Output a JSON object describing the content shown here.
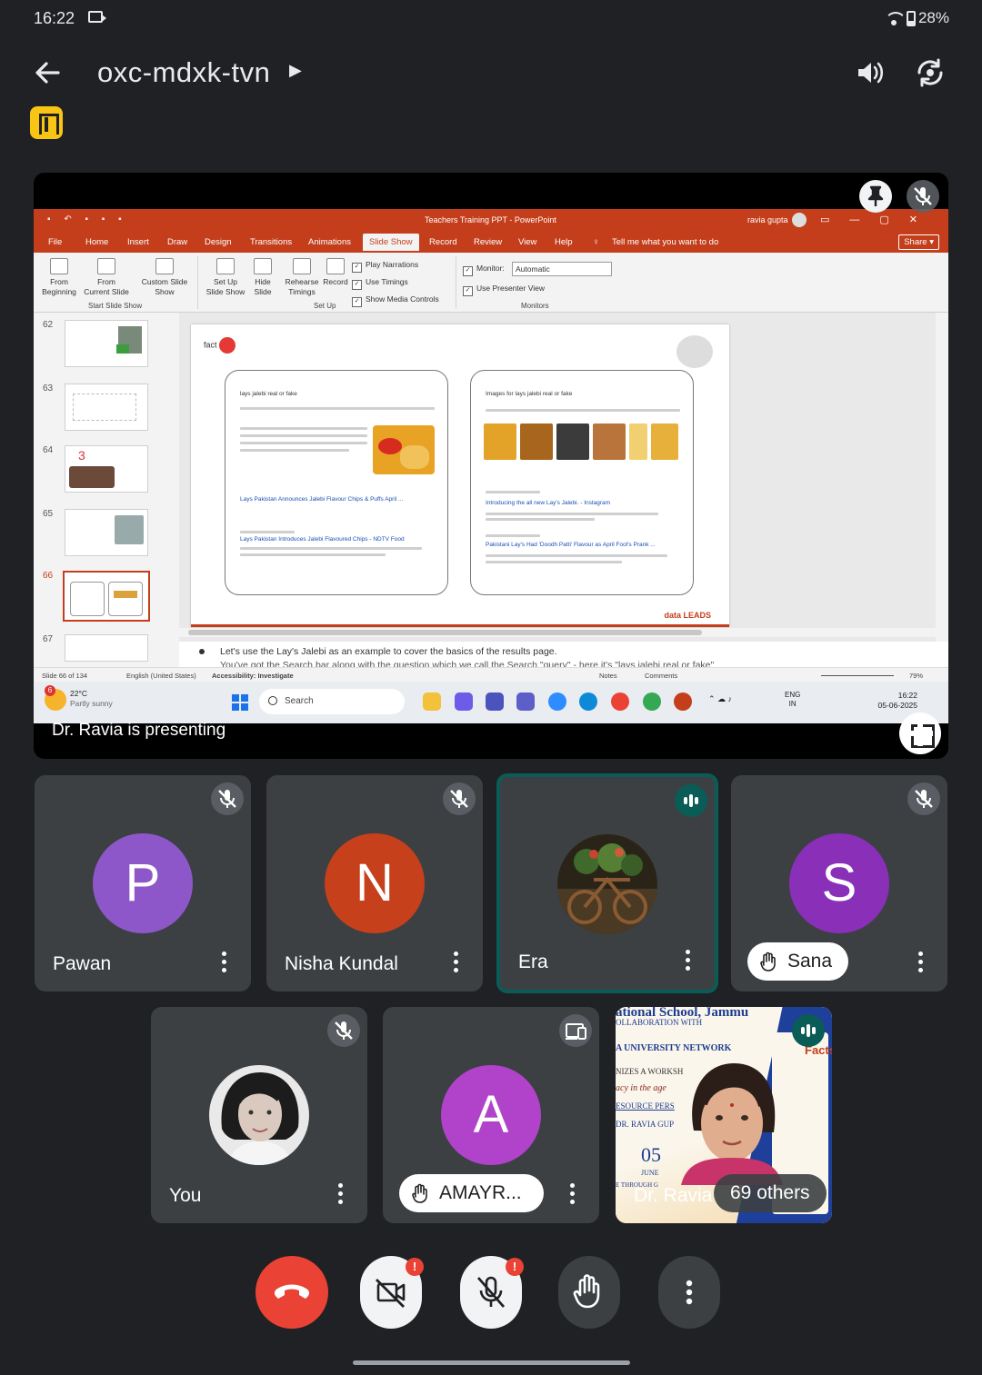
{
  "status_bar": {
    "time": "16:22",
    "battery": "28%"
  },
  "meeting": {
    "code": "oxc-mdxk-tvn"
  },
  "presentation": {
    "presenter_label": "Dr. Ravia is presenting",
    "ppt": {
      "window_title": "Teachers Training PPT  -  PowerPoint",
      "user": "ravia gupta",
      "tabs": [
        "File",
        "Home",
        "Insert",
        "Draw",
        "Design",
        "Transitions",
        "Animations",
        "Slide Show",
        "Record",
        "Review",
        "View",
        "Help"
      ],
      "tell_me": "Tell me what you want to do",
      "share": "Share",
      "ribbon": {
        "from_beginning": "From\nBeginning",
        "from_current": "From\nCurrent Slide",
        "custom_show": "Custom Slide\nShow",
        "group_start": "Start Slide Show",
        "set_up": "Set Up\nSlide Show",
        "hide_slide": "Hide\nSlide",
        "rehearse": "Rehearse\nTimings",
        "record": "Record",
        "play_narrations": "Play Narrations",
        "use_timings": "Use Timings",
        "show_media": "Show Media Controls",
        "group_setup": "Set Up",
        "monitor_label": "Monitor:",
        "monitor_value": "Automatic",
        "presenter_view": "Use Presenter View",
        "group_monitors": "Monitors"
      },
      "thumbnails": [
        "62",
        "63",
        "64",
        "65",
        "66",
        "67"
      ],
      "selected_thumbnail": "66",
      "slide": {
        "logo_text": "fact",
        "left_query": "lays jalebi real or fake",
        "left_result_1": "Lays Pakistan Announces Jalebi Flavour Chips & Puffs April ...",
        "left_result_2": "Lays Pakistan Introduces Jalebi Flavoured Chips - NDTV Food",
        "right_header": "Images for lays jalebi real or fake",
        "right_result_1": "Introducing the all new Lay's Jalebi. - Instagram",
        "right_result_2": "Pakistani Lay's Had 'Doodh Patti' Flavour as April Fool's Prank ...",
        "brand": "data LEADS"
      },
      "notes_line_1": "Let's use the Lay's Jalebi as an example to cover the basics of the results page.",
      "notes_line_2": "You've got the Search bar along with the question which we call the Search \"query\" - here it's \"lays jalebi real or fake\"",
      "status": {
        "slide_of": "Slide 66 of 134",
        "language": "English (United States)",
        "accessibility": "Accessibility: Investigate",
        "notes": "Notes",
        "comments": "Comments",
        "zoom": "79%"
      },
      "taskbar": {
        "temp": "22°C",
        "weather": "Partly sunny",
        "search": "Search",
        "lang_1": "ENG",
        "lang_2": "IN",
        "time": "16:22",
        "date": "05-06-2025"
      }
    }
  },
  "participants": [
    {
      "name": "Pawan",
      "initial": "P",
      "color": "#8e57c9",
      "muted": true
    },
    {
      "name": "Nisha Kundal",
      "initial": "N",
      "color": "#c5401b",
      "muted": true
    },
    {
      "name": "Era",
      "speaking": true
    },
    {
      "name": "Sana",
      "initial": "S",
      "color": "#8a2fb8",
      "muted": true,
      "hand_raised": true
    },
    {
      "name": "You",
      "muted": true
    },
    {
      "name": "AMAYR...",
      "initial": "A",
      "color": "#b043c9",
      "hand_raised": true,
      "presenting_device": true
    }
  ],
  "others_tile": {
    "name": "Dr. Ravia",
    "others": "69 others",
    "banner_lines": [
      "ational School, Jammu",
      "OLLABORATION WITH",
      "A UNIVERSITY NETWORK",
      "NIZES A WORKSH",
      "acy in the age",
      "ESOURCE PERS",
      "DR. RAVIA GUP",
      "05",
      "JUNE",
      "E THROUGH G"
    ],
    "side_text": "Facts"
  },
  "controls": {
    "camera_badge": "!",
    "mic_badge": "!"
  }
}
